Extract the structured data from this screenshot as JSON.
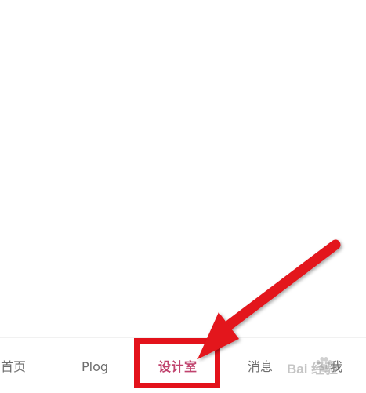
{
  "tabbar": {
    "tabs": [
      {
        "label": "首页"
      },
      {
        "label": "Plog"
      },
      {
        "label": "设计室"
      },
      {
        "label": "消息"
      },
      {
        "label": "我"
      }
    ]
  },
  "watermark": {
    "text": "Bai 经验"
  },
  "colors": {
    "active_tab": "#c0436e",
    "inactive_tab": "#6e6e6e",
    "annotation_red": "#e3121b"
  }
}
